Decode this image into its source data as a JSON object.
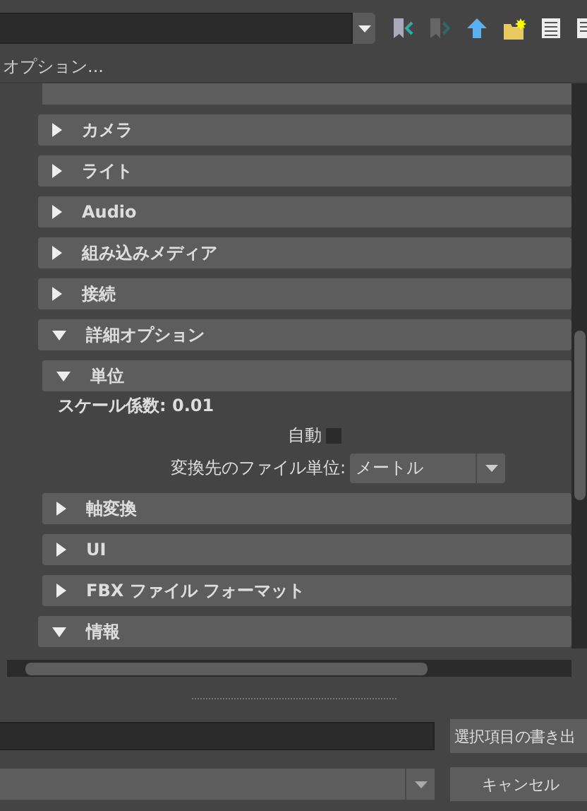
{
  "options_label": "オプション...",
  "sections": [
    {
      "label": "カメラ",
      "expanded": false,
      "kind": "group"
    },
    {
      "label": "ライト",
      "expanded": false,
      "kind": "group"
    },
    {
      "label": "Audio",
      "expanded": false,
      "kind": "group"
    },
    {
      "label": "組み込みメディア",
      "expanded": false,
      "kind": "group"
    },
    {
      "label": "接続",
      "expanded": false,
      "kind": "group"
    },
    {
      "label": "詳細オプション",
      "expanded": true,
      "kind": "group"
    },
    {
      "label": "単位",
      "expanded": true,
      "kind": "subgroup",
      "content": {
        "scale_label": "スケール係数: 0.01",
        "auto_label": "自動",
        "auto_checked": false,
        "unit_label": "変換先のファイル単位:",
        "unit_value": "メートル"
      }
    },
    {
      "label": "軸変換",
      "expanded": false,
      "kind": "subgroup"
    },
    {
      "label": "UI",
      "expanded": false,
      "kind": "subgroup"
    },
    {
      "label": "FBX ファイル フォーマット",
      "expanded": false,
      "kind": "subgroup"
    },
    {
      "label": "情報",
      "expanded": true,
      "kind": "group"
    }
  ],
  "buttons": [
    {
      "label": "選択項目の書き出"
    },
    {
      "label": "キャンセル"
    }
  ]
}
